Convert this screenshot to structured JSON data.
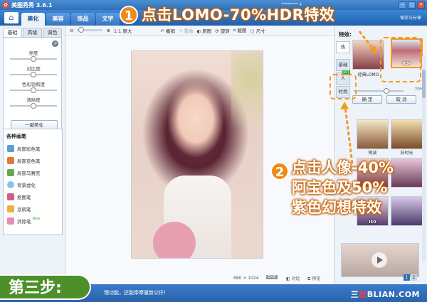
{
  "window": {
    "app_name": "美图秀秀 3.6.1",
    "user": "******** ▾",
    "controls": [
      "—",
      "□",
      "✕"
    ]
  },
  "main_tabs": [
    "美化",
    "美容",
    "饰品",
    "文字"
  ],
  "share": "保存与分享",
  "toolbar": {
    "actual_size": "1:1 原大",
    "undo": "撤销",
    "redo": "重做",
    "original": "原图",
    "rotate": "旋转",
    "crop": "截图",
    "resize": "尺寸"
  },
  "left_panel": {
    "subtabs": [
      "基础",
      "高级",
      "调色"
    ],
    "adjustments": [
      {
        "label": "亮度",
        "value": 0.5
      },
      {
        "label": "对比度",
        "value": 0.5
      },
      {
        "label": "色彩饱和度",
        "value": 0.5
      },
      {
        "label": "清晰度",
        "value": 0.5
      }
    ],
    "one_key_button": "一键美化",
    "brushes_title": "各种画笔",
    "brushes": [
      {
        "label": "局部彩色笔",
        "color": "#5aa0d8"
      },
      {
        "label": "局部变色笔",
        "color": "#e07a3a"
      },
      {
        "label": "局部马赛克",
        "color": "#6aa84f"
      },
      {
        "label": "背景虚化",
        "color": "#8fc1e8"
      },
      {
        "label": "抠图笔",
        "color": "#d35b8a"
      },
      {
        "label": "涂鸦笔",
        "color": "#e8b13a"
      },
      {
        "label": "消除笔",
        "color": "#e78bb0",
        "badge": "New"
      }
    ]
  },
  "status": {
    "dimensions": "680 × 1024",
    "exif": "EXIF",
    "compare": "对比",
    "preview": "预览"
  },
  "right_panel": {
    "title": "特效:",
    "vertical_tabs": [
      {
        "label": "热",
        "badge": ""
      },
      {
        "label": "基础",
        "badge": ""
      },
      {
        "label": "人",
        "badge": "HOT"
      },
      {
        "label": "时尚",
        "badge": ""
      }
    ],
    "effects": [
      {
        "caption": "经典LOMO",
        "label": ""
      },
      {
        "caption": "",
        "label": "HDR"
      },
      {
        "caption": "锐波",
        "label": ""
      },
      {
        "caption": "旧时光",
        "label": ""
      },
      {
        "caption": "",
        "label": ""
      },
      {
        "caption": "",
        "label": ""
      },
      {
        "caption": "",
        "label": "ISO"
      },
      {
        "caption": "",
        "label": ""
      }
    ],
    "opacity": "70%",
    "confirm": "确 定",
    "cancel": "取 消",
    "ad_pages": [
      "1",
      "2"
    ]
  },
  "bottom": {
    "tip": "理功能，还能牵摩量新公仔!",
    "watermark_pre": "三",
    "watermark_mid": "联",
    "watermark_post": "BLIAN.COM"
  },
  "overlay": {
    "step": "第三步:",
    "callout1_num": "1",
    "callout1_text": "点击LOMO-70%HDR特效",
    "callout2_num": "2",
    "callout2_lines": [
      "点击人像-40%",
      "阿宝色及50%",
      "紫色幻想特效"
    ]
  },
  "colors": {
    "accent_blue": "#2f6fb8",
    "callout_orange": "#ef8a1a",
    "step_green": "#4d8f2a"
  }
}
